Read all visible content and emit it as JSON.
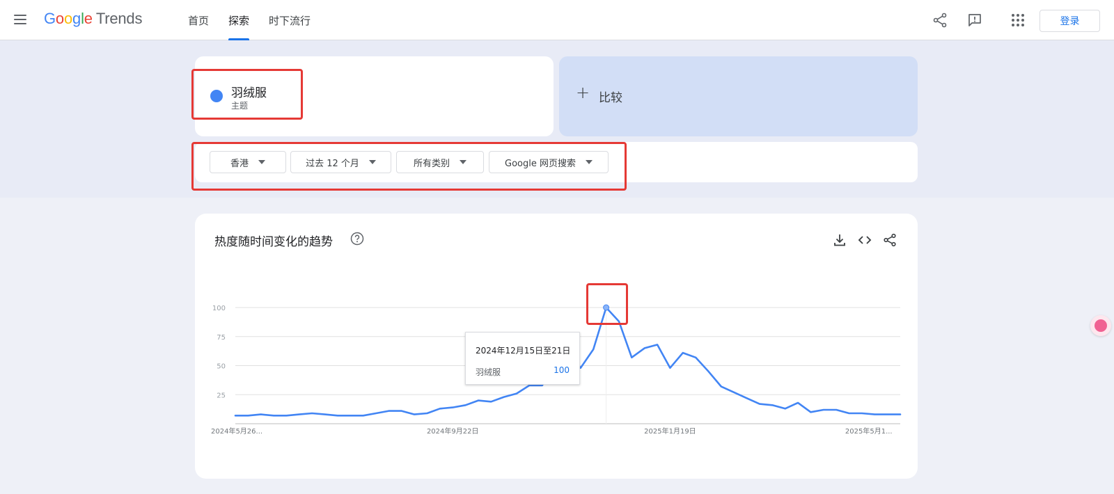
{
  "header": {
    "logo_google": [
      "G",
      "o",
      "o",
      "g",
      "l",
      "e"
    ],
    "logo_trends": "Trends",
    "tabs": [
      {
        "label": "首页",
        "active": false
      },
      {
        "label": "探索",
        "active": true
      },
      {
        "label": "时下流行",
        "active": false
      }
    ],
    "icons": [
      "menu-icon",
      "share-icon",
      "feedback-icon",
      "apps-icon"
    ],
    "login_label": "登录"
  },
  "search": {
    "term": "羽绒服",
    "term_type": "主题",
    "term_color": "#4285f4",
    "compare_label": "比较"
  },
  "filters": [
    {
      "label": "香港"
    },
    {
      "label": "过去 12 个月"
    },
    {
      "label": "所有类别"
    },
    {
      "label": "Google 网页搜索"
    }
  ],
  "trend_card": {
    "title": "热度随时间变化的趋势",
    "icons": [
      "help-icon",
      "download-icon",
      "embed-icon",
      "share-icon"
    ],
    "tooltip": {
      "date": "2024年12月15日至21日",
      "term": "羽绒服",
      "value": "100"
    }
  },
  "colors": {
    "accent": "#1a73e8",
    "series": "#4285f4",
    "highlight": "#e53935"
  },
  "chart_data": {
    "type": "line",
    "title": "热度随时间变化的趋势",
    "ylim": [
      0,
      100
    ],
    "y_ticks": [
      25,
      50,
      75,
      100
    ],
    "x_tick_labels": [
      "2024年5月26...",
      "2024年9月22日",
      "2025年1月19日",
      "2025年5月1..."
    ],
    "x_tick_index": [
      0,
      17,
      34,
      51
    ],
    "grid": true,
    "series": [
      {
        "name": "羽绒服",
        "values": [
          7,
          7,
          8,
          7,
          7,
          8,
          9,
          8,
          7,
          7,
          7,
          9,
          11,
          11,
          8,
          9,
          13,
          14,
          16,
          20,
          19,
          23,
          26,
          33,
          33,
          53,
          61,
          48,
          64,
          100,
          88,
          57,
          65,
          68,
          48,
          61,
          57,
          45,
          32,
          27,
          22,
          17,
          16,
          13,
          18,
          10,
          12,
          12,
          9,
          9,
          8,
          8,
          8
        ]
      }
    ],
    "highlight_index": 29
  }
}
